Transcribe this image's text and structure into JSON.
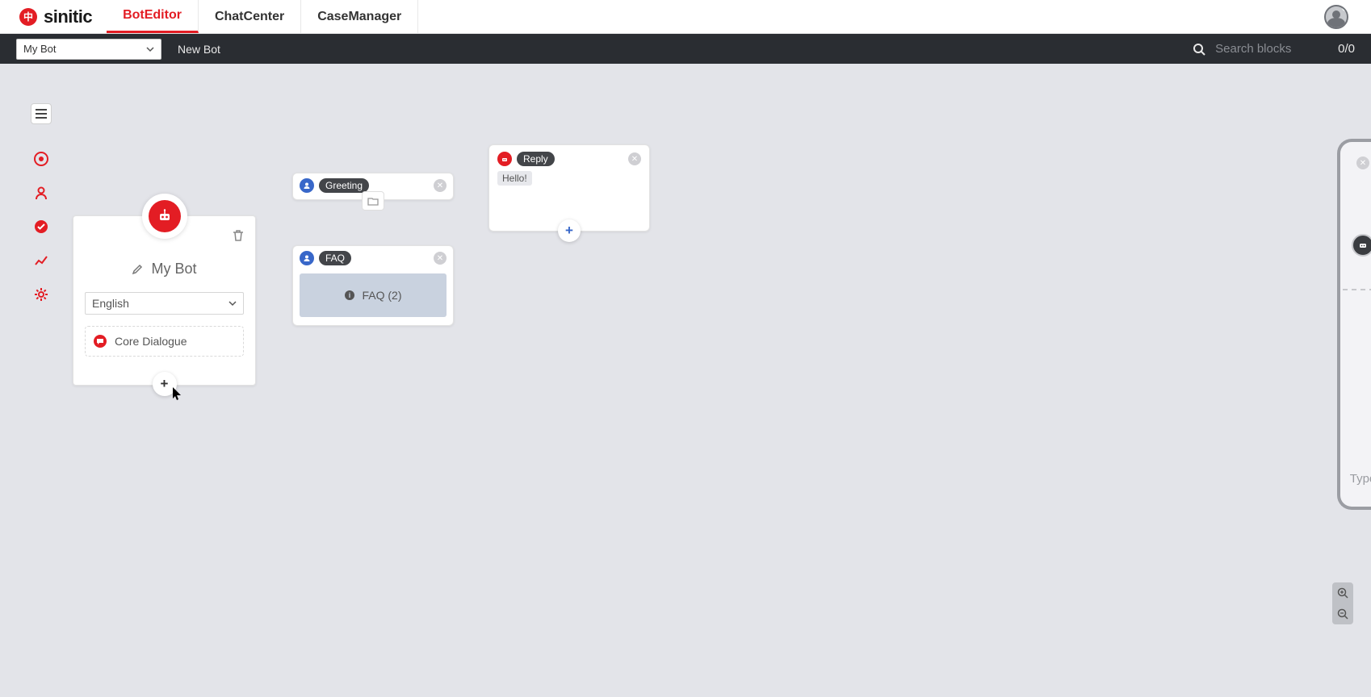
{
  "brand": {
    "name": "sinitic",
    "mark": "中"
  },
  "nav": {
    "tabs": [
      {
        "label": "BotEditor",
        "active": true
      },
      {
        "label": "ChatCenter",
        "active": false
      },
      {
        "label": "CaseManager",
        "active": false
      }
    ]
  },
  "subbar": {
    "selected_bot": "My Bot",
    "new_bot_label": "New Bot",
    "search_placeholder": "Search blocks",
    "counter": "0/0"
  },
  "sidebar_tools": [
    {
      "name": "bot-icon"
    },
    {
      "name": "user-icon"
    },
    {
      "name": "chat-check-icon"
    },
    {
      "name": "analytics-icon"
    },
    {
      "name": "gear-icon"
    }
  ],
  "bot_card": {
    "title": "My Bot",
    "language": "English",
    "core_dialogue_label": "Core Dialogue"
  },
  "nodes": {
    "greeting": {
      "label": "Greeting"
    },
    "faq": {
      "label": "FAQ",
      "body_label": "FAQ (2)"
    },
    "reply": {
      "label": "Reply",
      "message": "Hello!"
    }
  },
  "preview": {
    "type_placeholder": "Type"
  }
}
